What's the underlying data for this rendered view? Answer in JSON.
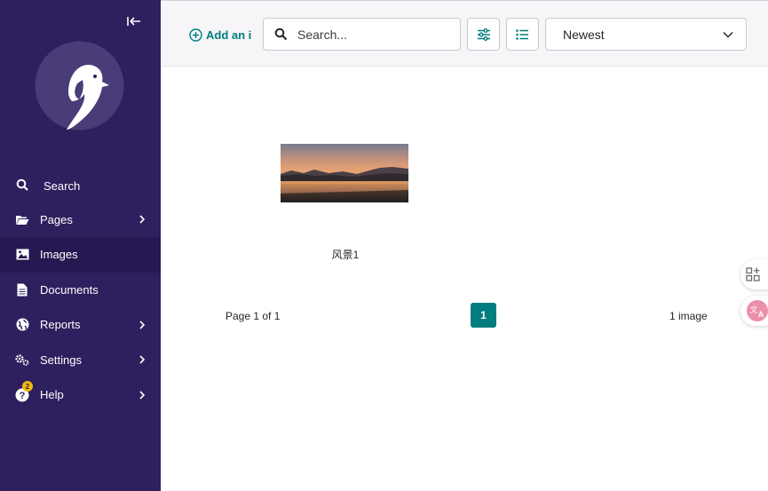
{
  "sidebar": {
    "collapse_icon": "collapse-left-arrow-icon",
    "logo": "wagtail-bird-logo",
    "items": [
      {
        "label": "Search",
        "icon": "search-icon",
        "has_submenu": false,
        "active": false
      },
      {
        "label": "Pages",
        "icon": "folder-open-icon",
        "has_submenu": true,
        "active": false
      },
      {
        "label": "Images",
        "icon": "image-icon",
        "has_submenu": false,
        "active": true
      },
      {
        "label": "Documents",
        "icon": "document-icon",
        "has_submenu": false,
        "active": false
      },
      {
        "label": "Reports",
        "icon": "globe-icon",
        "has_submenu": true,
        "active": false
      },
      {
        "label": "Settings",
        "icon": "cogs-icon",
        "has_submenu": true,
        "active": false
      },
      {
        "label": "Help",
        "icon": "help-icon",
        "has_submenu": true,
        "active": false,
        "badge": "2"
      }
    ]
  },
  "header": {
    "add_label": "Add an i",
    "search_placeholder": "Search...",
    "filter_icon": "sliders-icon",
    "list_view_icon": "list-icon",
    "sort_value": "Newest"
  },
  "gallery": {
    "images": [
      {
        "title": "风景1",
        "thumbnail": "sunset-lake-landscape"
      }
    ]
  },
  "pagination": {
    "page_info": "Page 1 of 1",
    "current_page": "1",
    "count": "1 image"
  },
  "floating": {
    "apps_icon": "apps-grid-icon",
    "translate_icon": "translate-icon"
  },
  "colors": {
    "sidebar_bg": "#2e1f5e",
    "accent": "#007d7e",
    "badge": "#f1b90e"
  }
}
